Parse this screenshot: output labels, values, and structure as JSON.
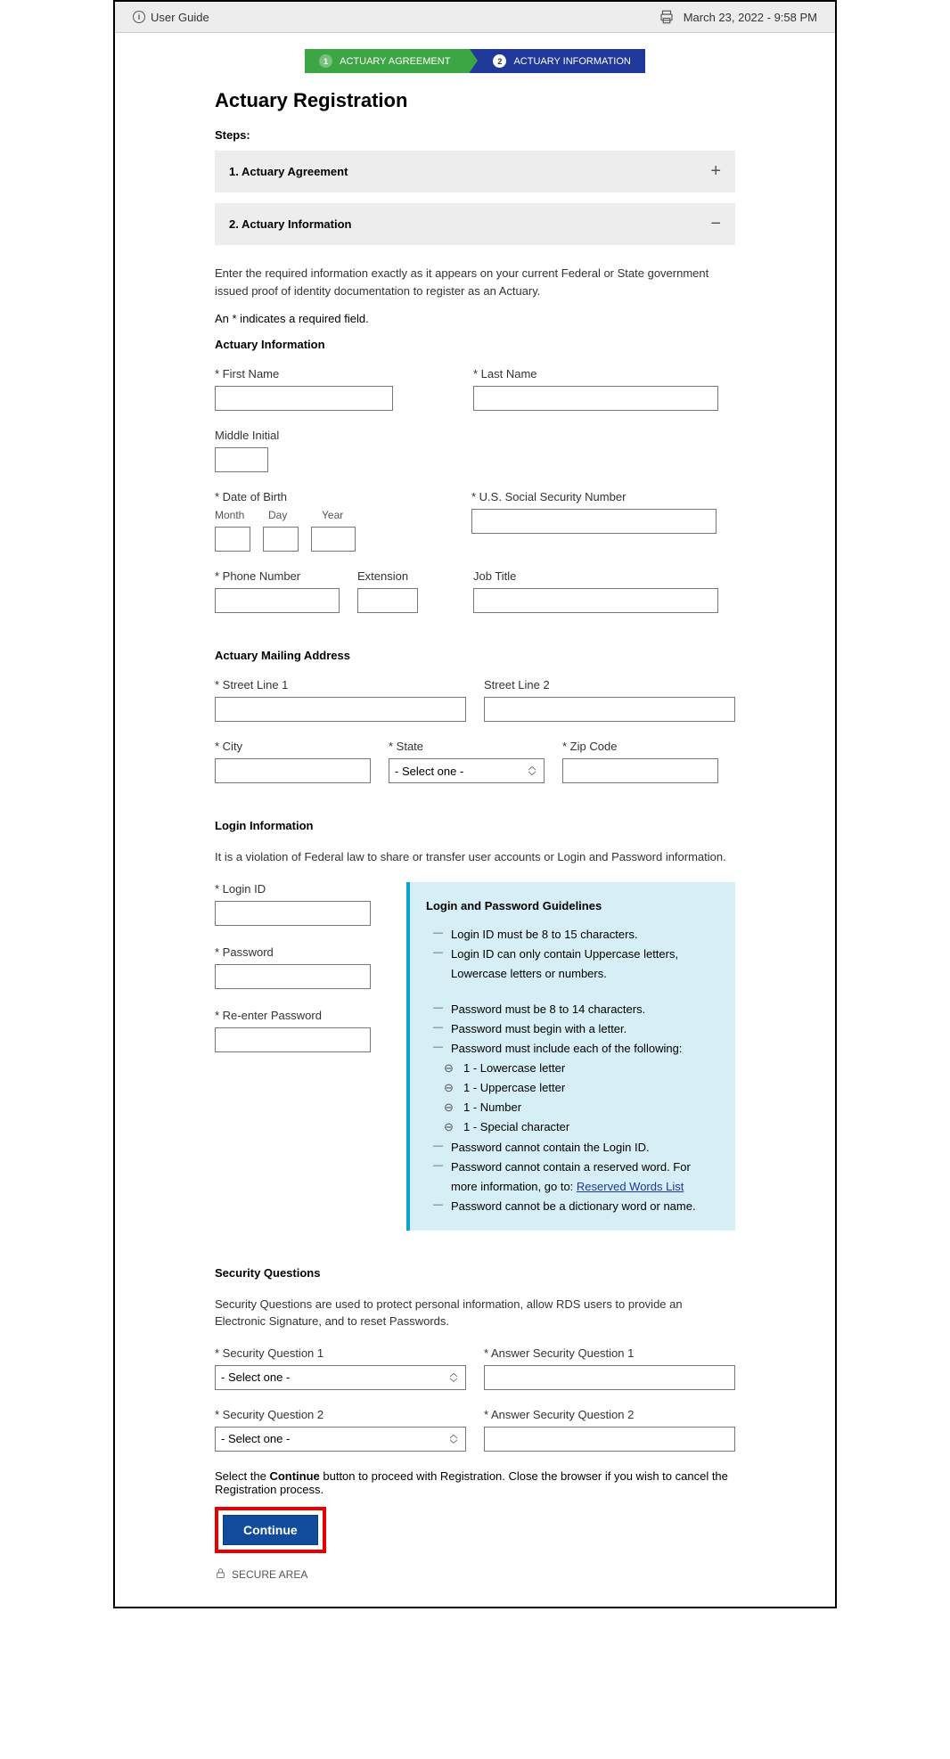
{
  "topbar": {
    "user_guide": "User Guide",
    "timestamp": "March 23, 2022 - 9:58 PM"
  },
  "stepper": {
    "step1": "ACTUARY AGREEMENT",
    "step2": "ACTUARY INFORMATION",
    "num1": "1",
    "num2": "2"
  },
  "page": {
    "title": "Actuary Registration",
    "steps_label": "Steps:"
  },
  "accordion": {
    "item1": "1. Actuary Agreement",
    "item2": "2. Actuary Information"
  },
  "intro": {
    "text": "Enter the required information exactly as it appears on your current Federal or State government issued proof of identity documentation to register as an Actuary.",
    "required_note": "An * indicates a required field."
  },
  "sections": {
    "actuary_info": "Actuary Information",
    "mailing": "Actuary Mailing Address",
    "login": "Login Information",
    "security": "Security Questions"
  },
  "labels": {
    "first_name": "* First Name",
    "last_name": "* Last Name",
    "middle_initial": "Middle Initial",
    "dob": "* Date of Birth",
    "dob_month": "Month",
    "dob_day": "Day",
    "dob_year": "Year",
    "ssn": "* U.S. Social Security Number",
    "phone": "* Phone Number",
    "extension": "Extension",
    "job_title": "Job Title",
    "street1": "* Street Line 1",
    "street2": "Street Line 2",
    "city": "* City",
    "state": "* State",
    "zip": "* Zip Code",
    "state_placeholder": "- Select one -",
    "login_id": "* Login ID",
    "password": "* Password",
    "re_password": "* Re-enter Password",
    "sq1": "* Security Question 1",
    "sq2": "* Security Question 2",
    "aq1": "* Answer Security Question 1",
    "aq2": "* Answer Security Question 2",
    "select_one": "- Select one -"
  },
  "login_intro": "It is a violation of Federal law to share or transfer user accounts or Login and Password information.",
  "guidelines": {
    "title": "Login and Password Guidelines",
    "l1": "Login ID must be 8 to 15 characters.",
    "l2": "Login ID can only contain Uppercase letters, Lowercase letters or numbers.",
    "p1": "Password must be 8 to 14 characters.",
    "p2": "Password must begin with a letter.",
    "p3": "Password must include each of the following:",
    "p3a": "1 - Lowercase letter",
    "p3b": "1 - Uppercase letter",
    "p3c": "1 - Number",
    "p3d": "1 - Special character",
    "p4": "Password cannot contain the Login ID.",
    "p5a": "Password cannot contain a reserved word. For more information, go to: ",
    "p5_link": "Reserved Words List",
    "p6": "Password cannot be a dictionary word or name."
  },
  "security_intro": "Security Questions are used to protect personal information, allow RDS users to provide an Electronic Signature, and to reset Passwords.",
  "continue": {
    "text_a": "Select the ",
    "text_bold": "Continue",
    "text_b": " button to proceed with Registration. Close the browser if you wish to cancel the Registration process.",
    "button": "Continue"
  },
  "secure": "SECURE AREA"
}
